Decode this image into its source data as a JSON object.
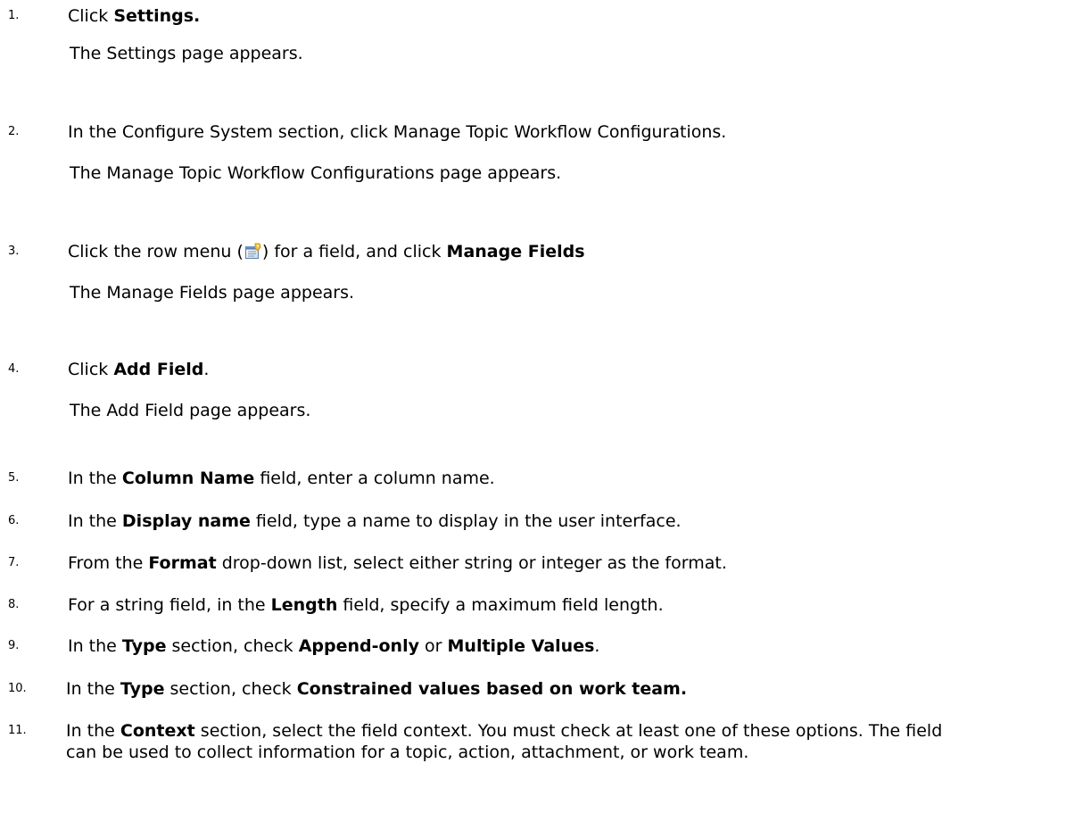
{
  "steps": [
    {
      "num": "1.",
      "parts": [
        "Click ",
        "Settings."
      ],
      "result": "The Settings page appears."
    },
    {
      "num": "2.",
      "text": "In the Configure System section, click Manage Topic Workflow Configurations.",
      "result": "The Manage Topic Workflow Configurations page appears."
    },
    {
      "num": "3.",
      "parts": [
        "Click the row menu (",
        ") for a field, and click ",
        "Manage Fields"
      ],
      "icon": "row-menu-icon",
      "result": "The Manage Fields page appears."
    },
    {
      "num": "4.",
      "parts": [
        "Click ",
        "Add Field",
        "."
      ],
      "result": "The Add Field page appears."
    },
    {
      "num": "5.",
      "parts": [
        "In the ",
        "Column Name",
        " field, enter a column name."
      ]
    },
    {
      "num": "6.",
      "parts": [
        "In the ",
        "Display name",
        " field, type a name to display in the user interface."
      ]
    },
    {
      "num": "7.",
      "parts": [
        "From the ",
        "Format",
        " drop-down list, select either string or integer as the format."
      ]
    },
    {
      "num": "8.",
      "parts": [
        "For a string field, in the ",
        "Length",
        " field, specify a maximum field length."
      ]
    },
    {
      "num": "9.",
      "parts": [
        "In the ",
        "Type",
        " section, check ",
        "Append-only",
        " or ",
        "Multiple Values",
        "."
      ]
    },
    {
      "num": "10.",
      "parts": [
        "In the ",
        "Type",
        " section, check ",
        "Constrained values based on work team."
      ]
    },
    {
      "num": "11.",
      "parts": [
        "In the ",
        "Context",
        " section, select the field context. You must check at least one of these options. The field can be used to collect information for a topic, action, attachment, or work team."
      ]
    }
  ]
}
